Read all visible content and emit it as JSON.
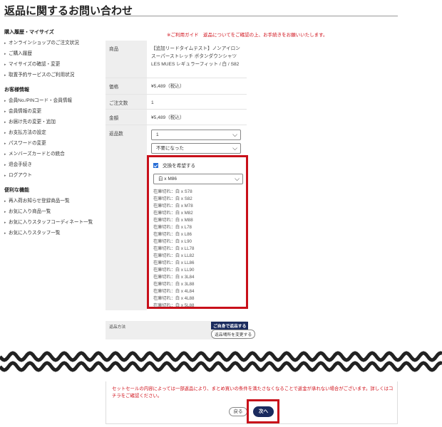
{
  "page": {
    "title": "返品に関するお問い合わせ"
  },
  "sidebar": {
    "sections": [
      {
        "heading": "購入履歴・マイサイズ",
        "items": [
          "オンラインショップのご注文状況",
          "ご購入履歴",
          "マイサイズの確認・変更",
          "取置予約サービスのご利用状況"
        ]
      },
      {
        "heading": "お客様情報",
        "items": [
          "会員No./PINコード・会員情報",
          "会員情報の変更",
          "お届け先の変更・追加",
          "お支払方法の設定",
          "パスワードの変更",
          "メンバーズカードとの統合",
          "退会手続き",
          "ログアウト"
        ]
      },
      {
        "heading": "便利な機能",
        "items": [
          "再入荷お知らせ登録商品一覧",
          "お気に入り商品一覧",
          "お気に入りスタッフコーディネート一覧",
          "お気に入りスタッフ一覧"
        ]
      }
    ]
  },
  "notice": "※ご利用ガイド　返品についてをご確認の上、お手続きをお願いいたします。",
  "form": {
    "product_label": "商品",
    "product_value": "【追加リードタイムテスト】ノンアイロン スーパーストレッチ ボタンダウンシャツ LES MUES レギュラーフィット / 白 / S82",
    "price_label": "価格",
    "price_value": "¥5,489（税込）",
    "qty_label": "ご注文数",
    "qty_value": "1",
    "amount_label": "金額",
    "amount_value": "¥5,489（税込）",
    "return_qty_label": "返品数",
    "return_qty_select": "1",
    "reason_select": "不要になった",
    "exchange_checkbox_label": "交換を希望する",
    "exchange_select": "白 x M86",
    "stock_options": [
      "在庫切れ：白 x S78",
      "在庫切れ：白 x S82",
      "在庫切れ：白 x M78",
      "在庫切れ：白 x M82",
      "在庫切れ：白 x M88",
      "在庫切れ：白 x L78",
      "在庫切れ：白 x L86",
      "在庫切れ：白 x L90",
      "在庫切れ：白 x LL78",
      "在庫切れ：白 x LL82",
      "在庫切れ：白 x LL86",
      "在庫切れ：白 x LL90",
      "在庫切れ：白 x 3L84",
      "在庫切れ：白 x 3L88",
      "在庫切れ：白 x 4L84",
      "在庫切れ：白 x 4L88",
      "在庫切れ：白 x 5L88"
    ],
    "return_method_label": "返品方法",
    "return_method_badge": "ご自身で返品する",
    "return_method_change": "返品場所を変更する"
  },
  "bottom": {
    "notice": "セットセールの内容によっては一部返品により、まとめ買いの条件を満たさなくなることで返金が承れない場合がございます。詳しくはコチラをご確認ください。",
    "back_label": "戻る",
    "next_label": "次へ"
  },
  "colors": {
    "accent_red": "#c8101a",
    "navy": "#1a2b5e",
    "notice_red": "#d0101a"
  }
}
